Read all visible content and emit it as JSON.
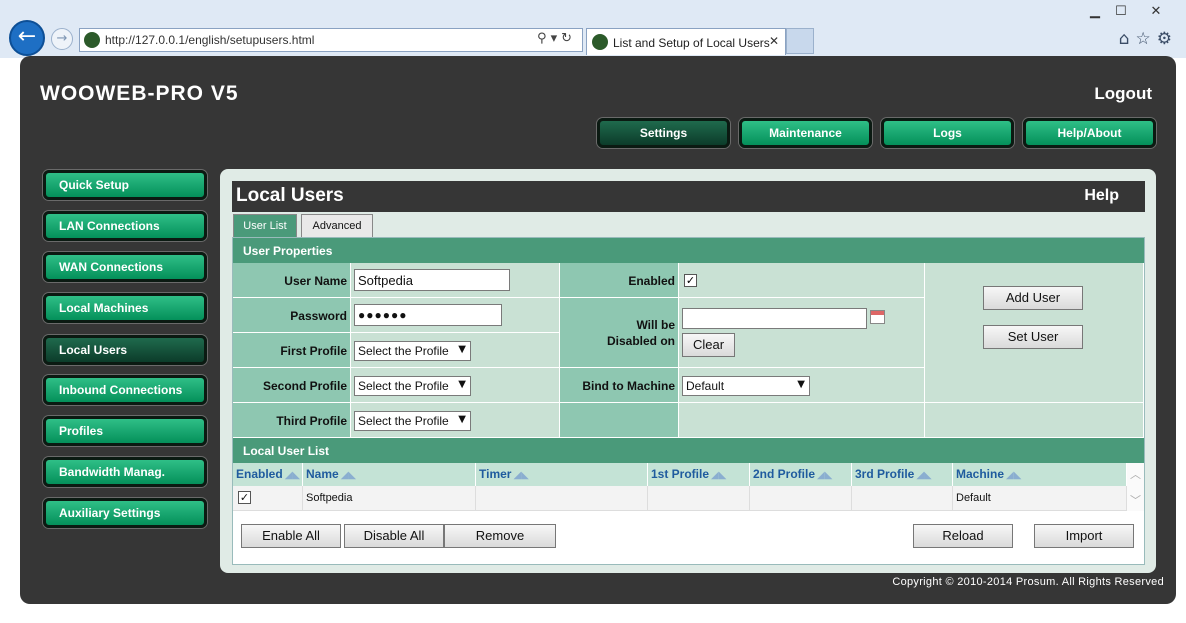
{
  "browser": {
    "url": "http://127.0.0.1/english/setupusers.html",
    "tab_title": "List and Setup of Local Users"
  },
  "app": {
    "brand": "WOOWEB-PRO V5",
    "logout": "Logout",
    "top_nav": [
      "Settings",
      "Maintenance",
      "Logs",
      "Help/About"
    ],
    "active_top": "Settings",
    "side_nav": [
      "Quick Setup",
      "LAN Connections",
      "WAN Connections",
      "Local Machines",
      "Local Users",
      "Inbound Connections",
      "Profiles",
      "Bandwidth Manag.",
      "Auxiliary Settings"
    ],
    "active_side": "Local Users",
    "copyright": "Copyright © 2010-2014 Prosum. All Rights Reserved"
  },
  "page": {
    "title": "Local Users",
    "help": "Help",
    "tabs": [
      "User List",
      "Advanced"
    ],
    "active_tab": "User List"
  },
  "props": {
    "header": "User Properties",
    "user_name_label": "User Name",
    "user_name_value": "Softpedia",
    "password_label": "Password",
    "password_value": "●●●●●●",
    "first_profile_label": "First Profile",
    "second_profile_label": "Second Profile",
    "third_profile_label": "Third Profile",
    "profile_select_value": "Select the Profile",
    "enabled_label": "Enabled",
    "enabled_checked": "✓",
    "disabled_on_label_1": "Will be",
    "disabled_on_label_2": "Disabled on",
    "clear_button": "Clear",
    "bind_label": "Bind to Machine",
    "bind_value": "Default",
    "add_user_button": "Add User",
    "set_user_button": "Set User"
  },
  "list": {
    "header": "Local User List",
    "columns": [
      "Enabled",
      "Name",
      "Timer",
      "1st Profile",
      "2nd Profile",
      "3rd Profile",
      "Machine"
    ],
    "rows": [
      {
        "enabled": "✓",
        "name": "Softpedia",
        "timer": "",
        "p1": "",
        "p2": "",
        "p3": "",
        "machine": "Default"
      }
    ],
    "buttons": {
      "enable_all": "Enable All",
      "disable_all": "Disable All",
      "remove": "Remove",
      "reload": "Reload",
      "import": "Import"
    }
  },
  "icons": {
    "back": "back-arrow-icon",
    "forward": "forward-arrow-icon",
    "search": "search-icon",
    "refresh": "refresh-icon",
    "home": "home-icon",
    "favorites": "star-icon",
    "settings": "gear-icon",
    "calendar": "calendar-icon"
  },
  "colors": {
    "green_button": "#04905a",
    "dark_frame": "#363636",
    "section_bar": "#4a9a7a",
    "label_cell": "#8ec7b1",
    "value_cell": "#c9e1d4"
  }
}
